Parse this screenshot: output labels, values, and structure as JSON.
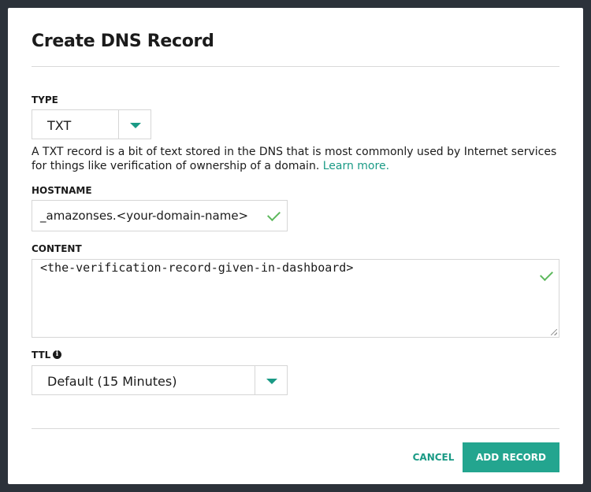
{
  "dialog": {
    "title": "Create DNS Record"
  },
  "type_field": {
    "label": "TYPE",
    "selected": "TXT"
  },
  "help": {
    "text": "A TXT record is a bit of text stored in the DNS that is most commonly used by Internet services for things like verification of ownership of a domain. ",
    "link_text": "Learn more."
  },
  "hostname_field": {
    "label": "HOSTNAME",
    "value": "_amazonses.<your-domain-name>"
  },
  "content_field": {
    "label": "CONTENT",
    "value": "<the-verification-record-given-in-dashboard>"
  },
  "ttl_field": {
    "label": "TTL",
    "info_icon": "info-icon",
    "selected": "Default (15 Minutes)"
  },
  "actions": {
    "cancel_label": "CANCEL",
    "add_label": "ADD RECORD"
  },
  "colors": {
    "accent": "#23a58f",
    "link": "#1a9a85",
    "valid_check": "#5cb85c",
    "backdrop": "#2c323a"
  }
}
